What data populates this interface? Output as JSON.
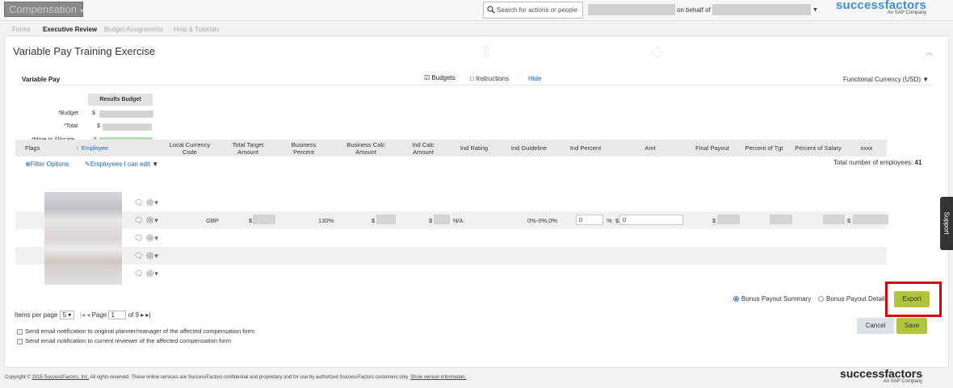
{
  "app": {
    "module_label": "Compensation",
    "search_placeholder": "Search for actions or people",
    "on_behalf_label": "on behalf of",
    "logo_name": "successfactors",
    "logo_sub": "An SAP Company"
  },
  "tabs": [
    "Forms",
    "Executive Review",
    "Budget Assignments",
    "Help & Tutorials"
  ],
  "page": {
    "title": "Variable Pay Training Exercise",
    "section_label": "Variable Pay",
    "budgets_link": "Budgets",
    "instructions_link": "Instructions",
    "hide_link": "Hide",
    "currency_label": "Functional Currency (USD)"
  },
  "budget": {
    "header": "Results Budget",
    "rows": [
      {
        "label": "*Budget",
        "symbol": "$"
      },
      {
        "label": "*Total",
        "symbol": "$"
      },
      {
        "label": "*More to Allocate:",
        "symbol": "$"
      }
    ]
  },
  "grid_toolbar": {
    "filter_label": "Filter Options",
    "employees_label": "Employees I can edit",
    "total_label": "Total number of employees:",
    "total_value": "41"
  },
  "grid": {
    "columns": [
      "Flags",
      "Employee",
      "Local Currency Code",
      "Total Target Amount",
      "Business Percent",
      "Business Calc Amount",
      "Ind Calc Amount",
      "Ind Rating",
      "Ind Guideline",
      "Ind Percent",
      "Amt",
      "Final Payout",
      "Percent of Tgt",
      "Percent of Salary",
      "xxxx"
    ],
    "row": {
      "currency": "GBP",
      "target_symbol": "$",
      "business_percent": "130%",
      "business_calc_symbol": "$",
      "ind_calc_symbol": "$",
      "ind_rating": "N/A",
      "ind_guideline": "0%-0%,0%",
      "ind_percent_value": "0",
      "ind_percent_symbol": "%",
      "amt_symbol": "$",
      "amt_value": "0",
      "final_payout_symbol": "$",
      "xxxx_symbol": "$"
    }
  },
  "bottom": {
    "radio_summary": "Bonus Payout Summary",
    "radio_details": "Bonus Payout Details",
    "export_label": "Export",
    "cancel_label": "Cancel",
    "save_label": "Save",
    "items_per_page_label": "Items per page",
    "items_per_page_value": "5",
    "page_label": "Page",
    "page_value": "1",
    "of_label": "of 9",
    "notify_1": "Send email notification to original planner/manager of the affected compensation form",
    "notify_2": "Send email notification to current reviewer of the affected compensation form"
  },
  "support_label": "Support",
  "footer": {
    "copyright_prefix": "Copyright ©",
    "copyright_link": "2015 SuccessFactors, Inc.",
    "copyright_rest": "All rights reserved. These online services are SuccessFactors confidential and proprietary and for use by authorized SuccessFactors customers only.",
    "version_link": "Show version information."
  }
}
